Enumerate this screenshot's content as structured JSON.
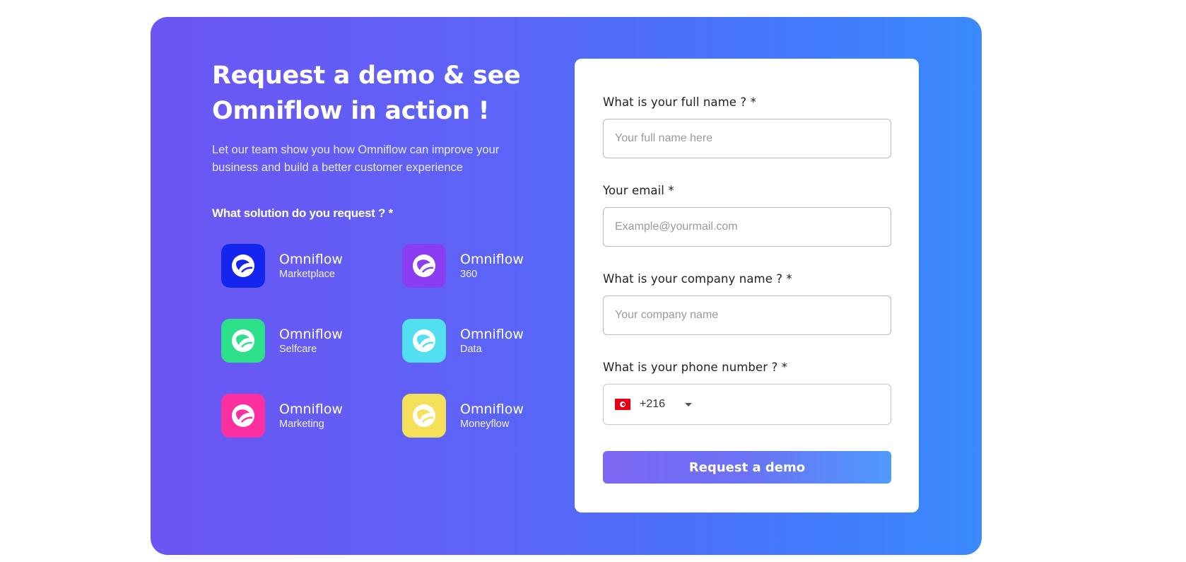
{
  "hero": {
    "title_line1": "Request a demo & see",
    "title_line2": "Omniflow in action !",
    "subtitle_line1": "Let our team show you how Omniflow can improve your",
    "subtitle_line2": "business and build a better customer experience",
    "solution_question": "What solution do you request ? *"
  },
  "solutions": [
    {
      "name": "Omniflow",
      "product": "Marketplace",
      "color": "#1525f0",
      "icon": "omniflow-logo-icon"
    },
    {
      "name": "Omniflow",
      "product": "360",
      "color": "#8a3cf0",
      "icon": "omniflow-logo-icon"
    },
    {
      "name": "Omniflow",
      "product": "Selfcare",
      "color": "#2fe08a",
      "icon": "omniflow-logo-icon"
    },
    {
      "name": "Omniflow",
      "product": "Data",
      "color": "#52dff0",
      "icon": "omniflow-logo-icon"
    },
    {
      "name": "Omniflow",
      "product": "Marketing",
      "color": "#fb2fa0",
      "icon": "omniflow-logo-icon"
    },
    {
      "name": "Omniflow",
      "product": "Moneyflow",
      "color": "#f5e05a",
      "icon": "omniflow-logo-icon"
    }
  ],
  "form": {
    "full_name": {
      "label": "What is your full name ? *",
      "placeholder": "Your full name here"
    },
    "email": {
      "label": "Your email *",
      "placeholder": "Example@yourmail.com"
    },
    "company": {
      "label": "What is your company name ? *",
      "placeholder": "Your company name"
    },
    "phone": {
      "label": "What is your phone number ? *",
      "dial_code": "+216",
      "flag": "tunisia-flag-icon"
    },
    "submit_label": "Request a demo"
  }
}
